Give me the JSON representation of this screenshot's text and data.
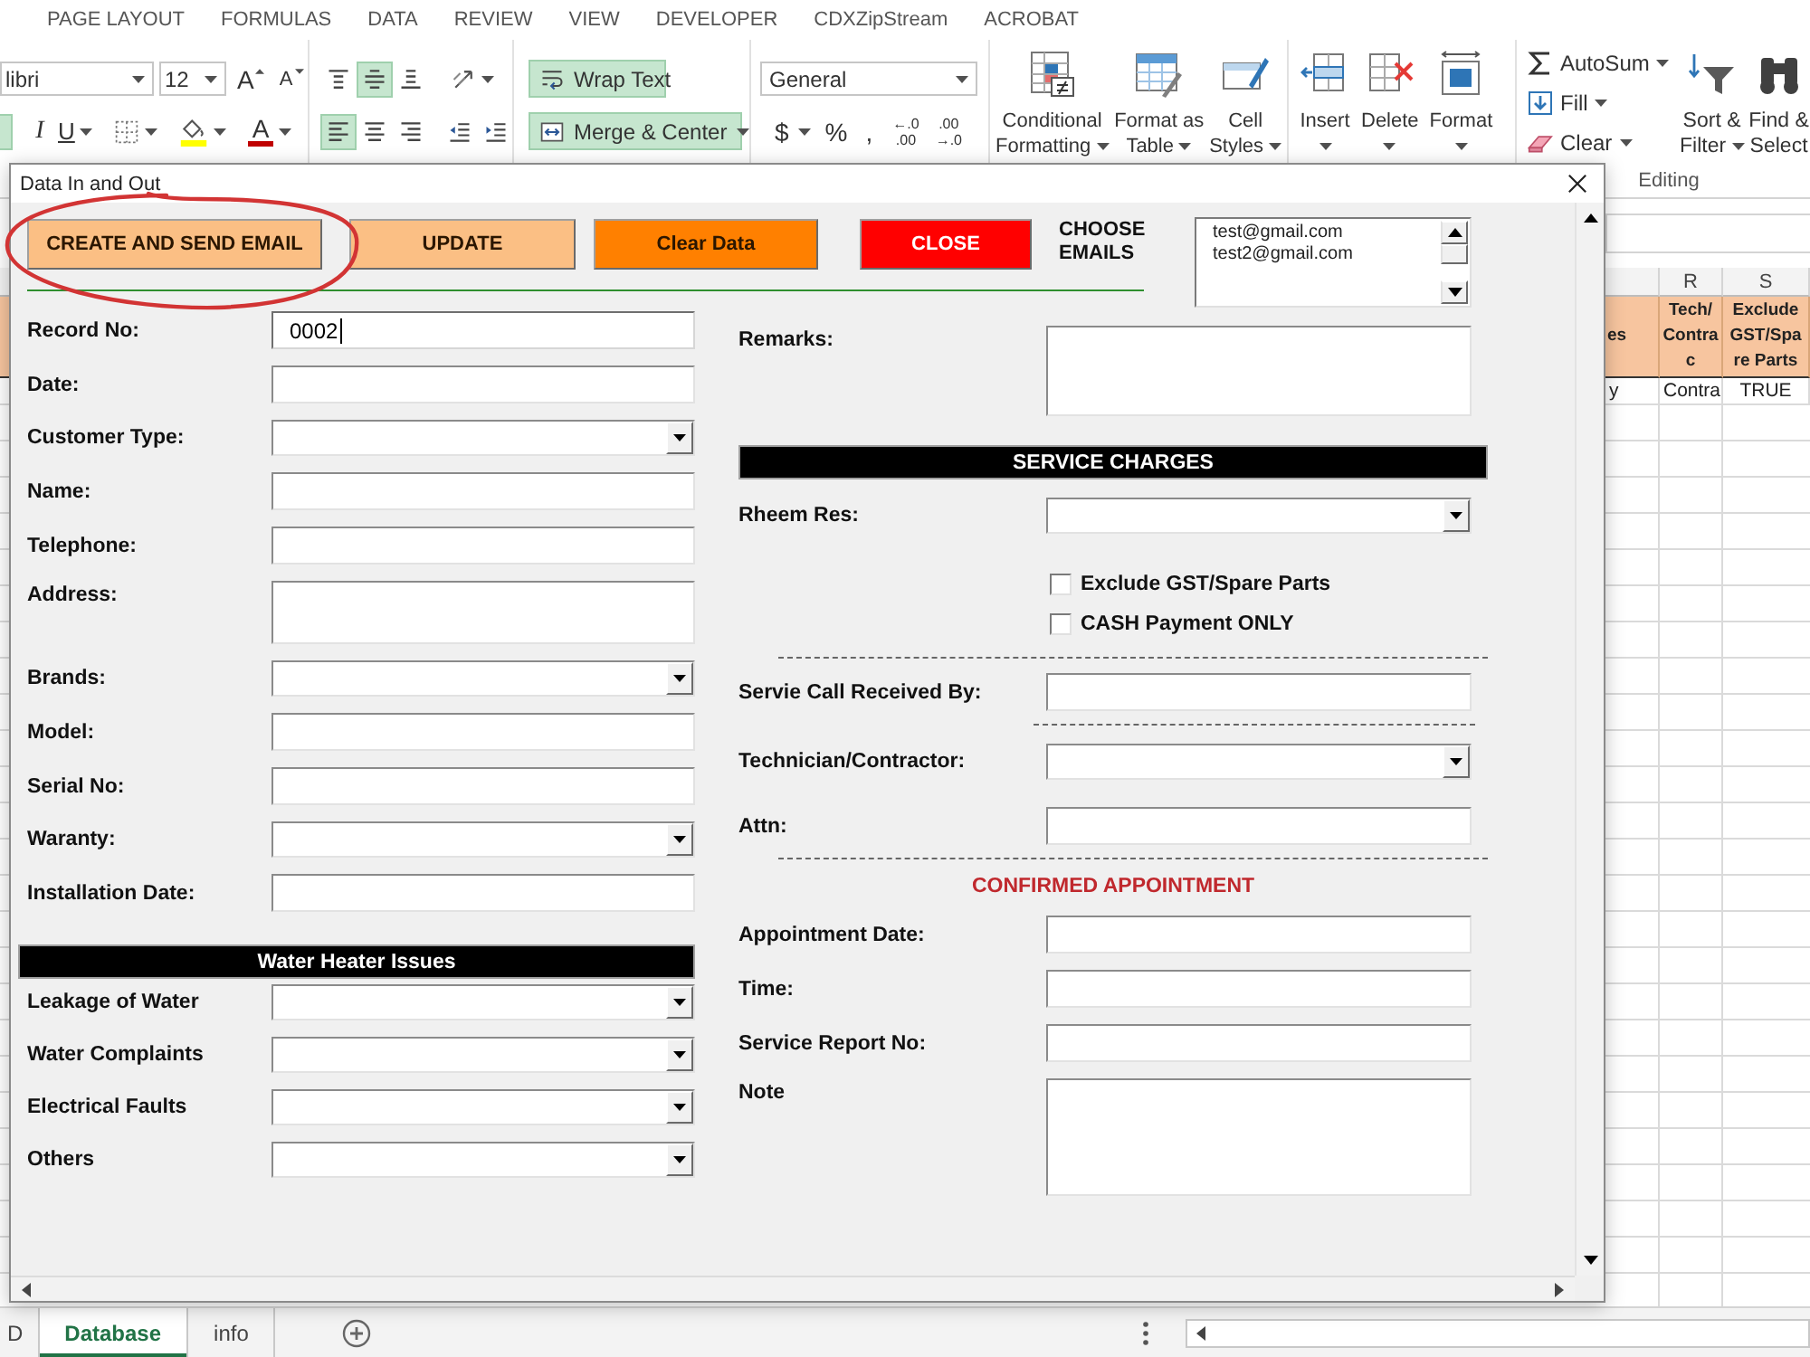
{
  "ribbon": {
    "tabs": [
      {
        "label": "PAGE LAYOUT",
        "selected": false
      },
      {
        "label": "FORMULAS",
        "selected": false
      },
      {
        "label": "DATA",
        "selected": false
      },
      {
        "label": "REVIEW",
        "selected": false
      },
      {
        "label": "VIEW",
        "selected": false
      },
      {
        "label": "DEVELOPER",
        "selected": false
      },
      {
        "label": "CDXZipStream",
        "selected": false
      },
      {
        "label": "ACROBAT",
        "selected": false
      }
    ],
    "font": {
      "name": "libri",
      "size": "12",
      "grow": "A",
      "shrink": "A",
      "bold_on": true,
      "italic": "I",
      "underline": "U",
      "color_letter": "A"
    },
    "alignment": [
      {
        "kind": "top",
        "on": false
      },
      {
        "kind": "middle",
        "on": true
      },
      {
        "kind": "bottom",
        "on": false
      },
      {
        "kind": "left",
        "on": true
      },
      {
        "kind": "center",
        "on": false
      },
      {
        "kind": "right",
        "on": false
      }
    ],
    "wrap_text": {
      "label": "Wrap Text",
      "on": true
    },
    "merge": {
      "label": "Merge & Center",
      "on": true
    },
    "number": {
      "format": "General",
      "currency": "$",
      "percent": "%",
      "comma": ",",
      "decimals": [
        {
          "top": "←.0",
          "bottom": ".00"
        },
        {
          "top": ".00",
          "bottom": "→.0"
        }
      ]
    },
    "styles": [
      {
        "kind": "conditional",
        "lines": [
          "Conditional",
          "Formatting"
        ]
      },
      {
        "kind": "table",
        "lines": [
          "Format as",
          "Table"
        ]
      },
      {
        "kind": "cellstyles",
        "lines": [
          "Cell",
          "Styles"
        ]
      }
    ],
    "cells": [
      {
        "kind": "insert",
        "label": "Insert"
      },
      {
        "kind": "delete",
        "label": "Delete"
      },
      {
        "kind": "format",
        "label": "Format"
      }
    ],
    "editing": {
      "small": [
        {
          "kind": "autosum",
          "label": "AutoSum"
        },
        {
          "kind": "fill",
          "label": "Fill"
        },
        {
          "kind": "clear",
          "label": "Clear"
        }
      ],
      "large": [
        {
          "kind": "sort",
          "lines": [
            "Sort &",
            "Filter"
          ]
        },
        {
          "kind": "find",
          "lines": [
            "Find &",
            "Select"
          ]
        }
      ],
      "group_label": "Editing"
    }
  },
  "sheet": {
    "columns": [
      "R",
      "S"
    ],
    "header_cells": [
      "es",
      "Tech/\nContra\nc",
      "Exclude\nGST/Spa\nre Parts"
    ],
    "row_cells": [
      "y",
      "Contra",
      "TRUE"
    ]
  },
  "dialog": {
    "title": "Data In and Out",
    "buttons": [
      {
        "label": "CREATE AND SEND EMAIL",
        "color": "#fbbf84"
      },
      {
        "label": "UPDATE",
        "color": "#fbbf84"
      },
      {
        "label": "Clear Data",
        "color": "#ff8000"
      },
      {
        "label": "CLOSE",
        "color": "#ff0000"
      }
    ],
    "choose_label": "CHOOSE EMAILS",
    "emails": [
      {
        "label": "test@gmail.com",
        "selected": false
      },
      {
        "label": "test2@gmail.com",
        "selected": false
      }
    ],
    "left_fields": [
      {
        "kind": "text",
        "label": "Record No:",
        "value": "0002",
        "focused": true
      },
      {
        "kind": "text",
        "label": "Date:",
        "focused": false
      },
      {
        "kind": "dropdown",
        "label": "Customer Type:",
        "focused": false
      },
      {
        "kind": "text",
        "label": "Name:",
        "focused": false
      },
      {
        "kind": "text",
        "label": "Telephone:",
        "focused": false
      },
      {
        "kind": "textarea",
        "label": "Address:",
        "focused": false
      },
      {
        "kind": "dropdown",
        "label": "Brands:",
        "focused": false
      },
      {
        "kind": "text",
        "label": "Model:",
        "focused": false
      },
      {
        "kind": "text",
        "label": "Serial No:",
        "focused": false
      },
      {
        "kind": "dropdown",
        "label": "Waranty:",
        "focused": false
      },
      {
        "kind": "text",
        "label": "Installation Date:",
        "focused": false
      },
      {
        "kind": "header",
        "label": "Water Heater Issues"
      },
      {
        "kind": "dropdown",
        "label": "Leakage of Water",
        "focused": false
      },
      {
        "kind": "dropdown",
        "label": "Water Complaints",
        "focused": false
      },
      {
        "kind": "dropdown",
        "label": "Electrical Faults",
        "focused": false
      },
      {
        "kind": "dropdown",
        "label": "Others",
        "focused": false
      }
    ],
    "right_fields": [
      {
        "kind": "textarea",
        "label": "Remarks:",
        "focused": false
      },
      {
        "kind": "header",
        "label": "SERVICE CHARGES"
      },
      {
        "kind": "dropdown",
        "label": "Rheem Res:",
        "focused": false
      },
      {
        "kind": "checkbox",
        "label": "Exclude GST/Spare Parts",
        "checked": false
      },
      {
        "kind": "checkbox",
        "label": "CASH Payment ONLY",
        "checked": false
      },
      {
        "kind": "divider"
      },
      {
        "kind": "text",
        "label": "Servie Call Received By:",
        "focused": false
      },
      {
        "kind": "subdivider"
      },
      {
        "kind": "dropdown",
        "label": "Technician/Contractor:",
        "focused": false
      },
      {
        "kind": "text",
        "label": "Attn:",
        "focused": false
      },
      {
        "kind": "divider"
      },
      {
        "kind": "subheading",
        "label": "CONFIRMED APPOINTMENT"
      },
      {
        "kind": "text",
        "label": "Appointment Date:",
        "focused": false
      },
      {
        "kind": "text",
        "label": "Time:",
        "focused": false
      },
      {
        "kind": "text",
        "label": "Service Report No:",
        "focused": false
      },
      {
        "kind": "textarea",
        "label": "Note",
        "focused": false
      }
    ]
  },
  "sheet_tabs": [
    {
      "label": "D",
      "selected": false
    },
    {
      "label": "Database",
      "selected": true
    },
    {
      "label": "info",
      "selected": false
    }
  ]
}
